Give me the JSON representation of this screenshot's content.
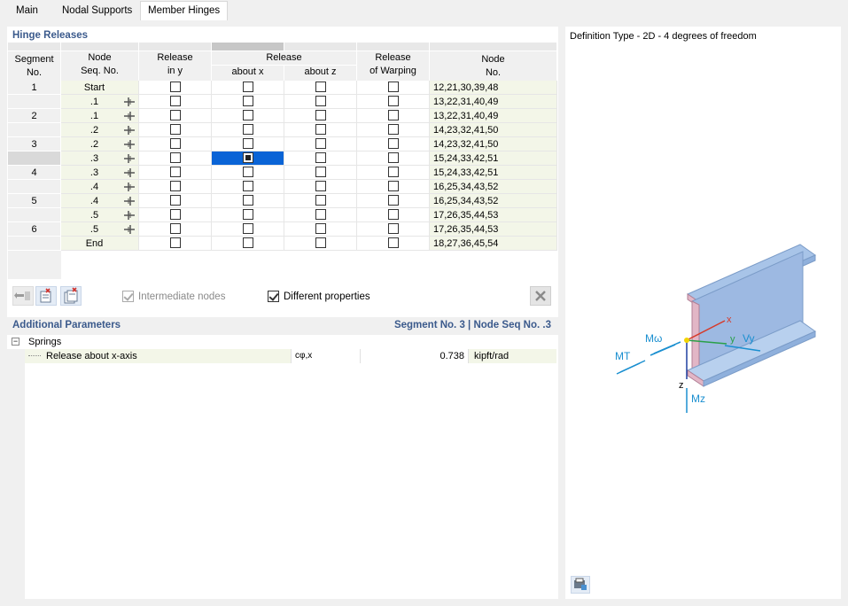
{
  "tabs": [
    {
      "label": "Main"
    },
    {
      "label": "Nodal Supports"
    },
    {
      "label": "Member Hinges"
    }
  ],
  "hinge_releases": {
    "title": "Hinge Releases",
    "headers": {
      "segment_line1": "Segment",
      "segment_line2": "No.",
      "node_seq_line1": "Node",
      "node_seq_line2": "Seq. No.",
      "release_y_line1": "Release",
      "release_y_line2": "in y",
      "release_group": "Release",
      "about_x": "about x",
      "about_z": "about z",
      "warping_line1": "Release",
      "warping_line2": "of Warping",
      "node_no_line1": "Node",
      "node_no_line2": "No."
    },
    "rows": [
      {
        "segment": "1",
        "node_seq": "Start",
        "hinge": "",
        "node_no": "12,21,30,39,48"
      },
      {
        "segment": "",
        "node_seq": ".1",
        "hinge": "left",
        "node_no": "13,22,31,40,49"
      },
      {
        "segment": "2",
        "node_seq": ".1",
        "hinge": "right",
        "node_no": "13,22,31,40,49"
      },
      {
        "segment": "",
        "node_seq": ".2",
        "hinge": "left",
        "node_no": "14,23,32,41,50"
      },
      {
        "segment": "3",
        "node_seq": ".2",
        "hinge": "right",
        "node_no": "14,23,32,41,50"
      },
      {
        "segment": "",
        "node_seq": ".3",
        "hinge": "left",
        "node_no": "15,24,33,42,51"
      },
      {
        "segment": "4",
        "node_seq": ".3",
        "hinge": "right",
        "node_no": "15,24,33,42,51"
      },
      {
        "segment": "",
        "node_seq": ".4",
        "hinge": "left",
        "node_no": "16,25,34,43,52"
      },
      {
        "segment": "5",
        "node_seq": ".4",
        "hinge": "right",
        "node_no": "16,25,34,43,52"
      },
      {
        "segment": "",
        "node_seq": ".5",
        "hinge": "left",
        "node_no": "17,26,35,44,53"
      },
      {
        "segment": "6",
        "node_seq": ".5",
        "hinge": "right",
        "node_no": "17,26,35,44,53"
      },
      {
        "segment": "",
        "node_seq": "End",
        "hinge": "",
        "node_no": "18,27,36,45,54"
      }
    ]
  },
  "options": {
    "intermediate_nodes_label": "Intermediate nodes",
    "intermediate_nodes_checked": true,
    "different_properties_label": "Different properties",
    "different_properties_checked": true
  },
  "additional_parameters": {
    "title": "Additional Parameters",
    "context": "Segment No. 3 | Node Seq No. .3",
    "group_label": "Springs",
    "row": {
      "label": "Release about x-axis",
      "symbol": "cφ,x",
      "value": "0.738",
      "unit": "kipft/rad"
    }
  },
  "definition": {
    "title": "Definition Type - 2D - 4 degrees of freedom",
    "labels": {
      "mt": "MT",
      "mw": "Mω",
      "vy": "Vy",
      "mz": "Mz",
      "x": "x",
      "y": "y",
      "z": "z"
    }
  },
  "colors": {
    "accent": "#3b5a8c",
    "selection": "#0a64d6",
    "row_tint": "#f3f6e8",
    "beam": "#a8c4e8",
    "load_arrow": "#1a8fd0"
  }
}
